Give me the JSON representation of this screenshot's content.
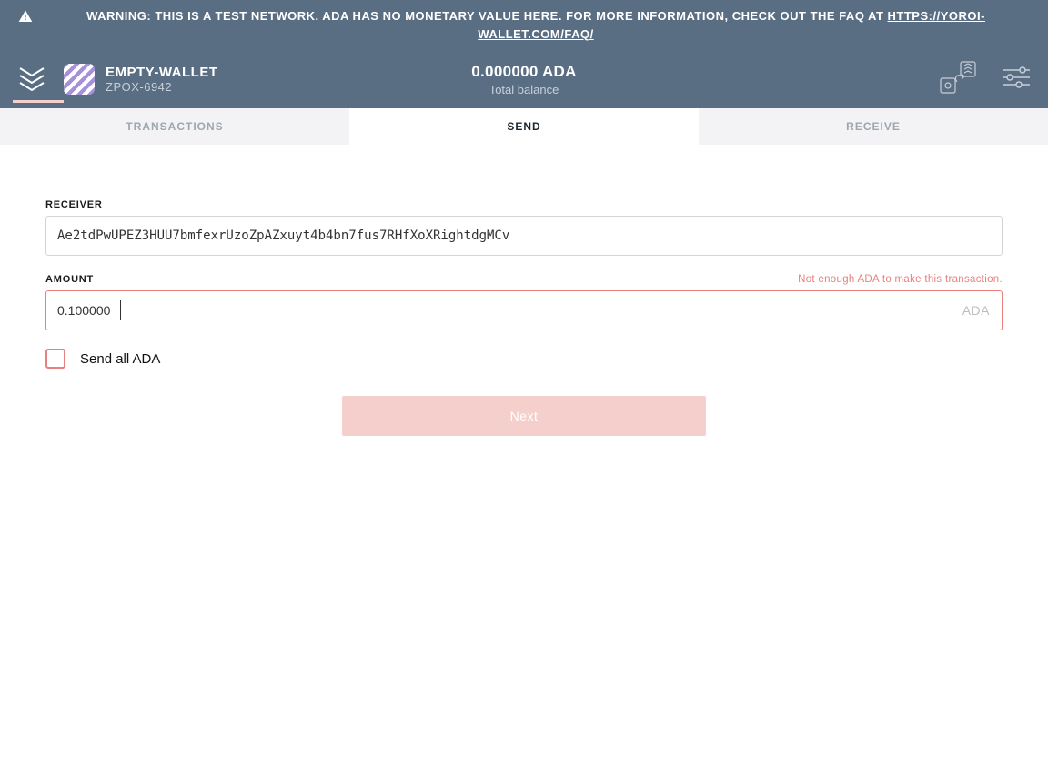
{
  "warning": {
    "prefix": "WARNING: THIS IS A TEST NETWORK. ADA HAS NO MONETARY VALUE HERE. FOR MORE INFORMATION, CHECK OUT THE FAQ AT ",
    "link_text": "HTTPS://YOROI-WALLET.COM/FAQ/"
  },
  "header": {
    "wallet_name": "EMPTY-WALLET",
    "wallet_id": "ZPOX-6942",
    "balance_amount": "0.000000 ADA",
    "balance_label": "Total balance"
  },
  "tabs": {
    "transactions": "TRANSACTIONS",
    "send": "SEND",
    "receive": "RECEIVE"
  },
  "form": {
    "receiver_label": "RECEIVER",
    "receiver_value": "Ae2tdPwUPEZ3HUU7bmfexrUzoZpAZxuyt4b4bn7fus7RHfXoXRightdgMCv",
    "amount_label": "AMOUNT",
    "amount_value": "0.100000",
    "amount_suffix": "ADA",
    "amount_error": "Not enough ADA to make this transaction.",
    "send_all_label": "Send all ADA",
    "next_label": "Next"
  }
}
